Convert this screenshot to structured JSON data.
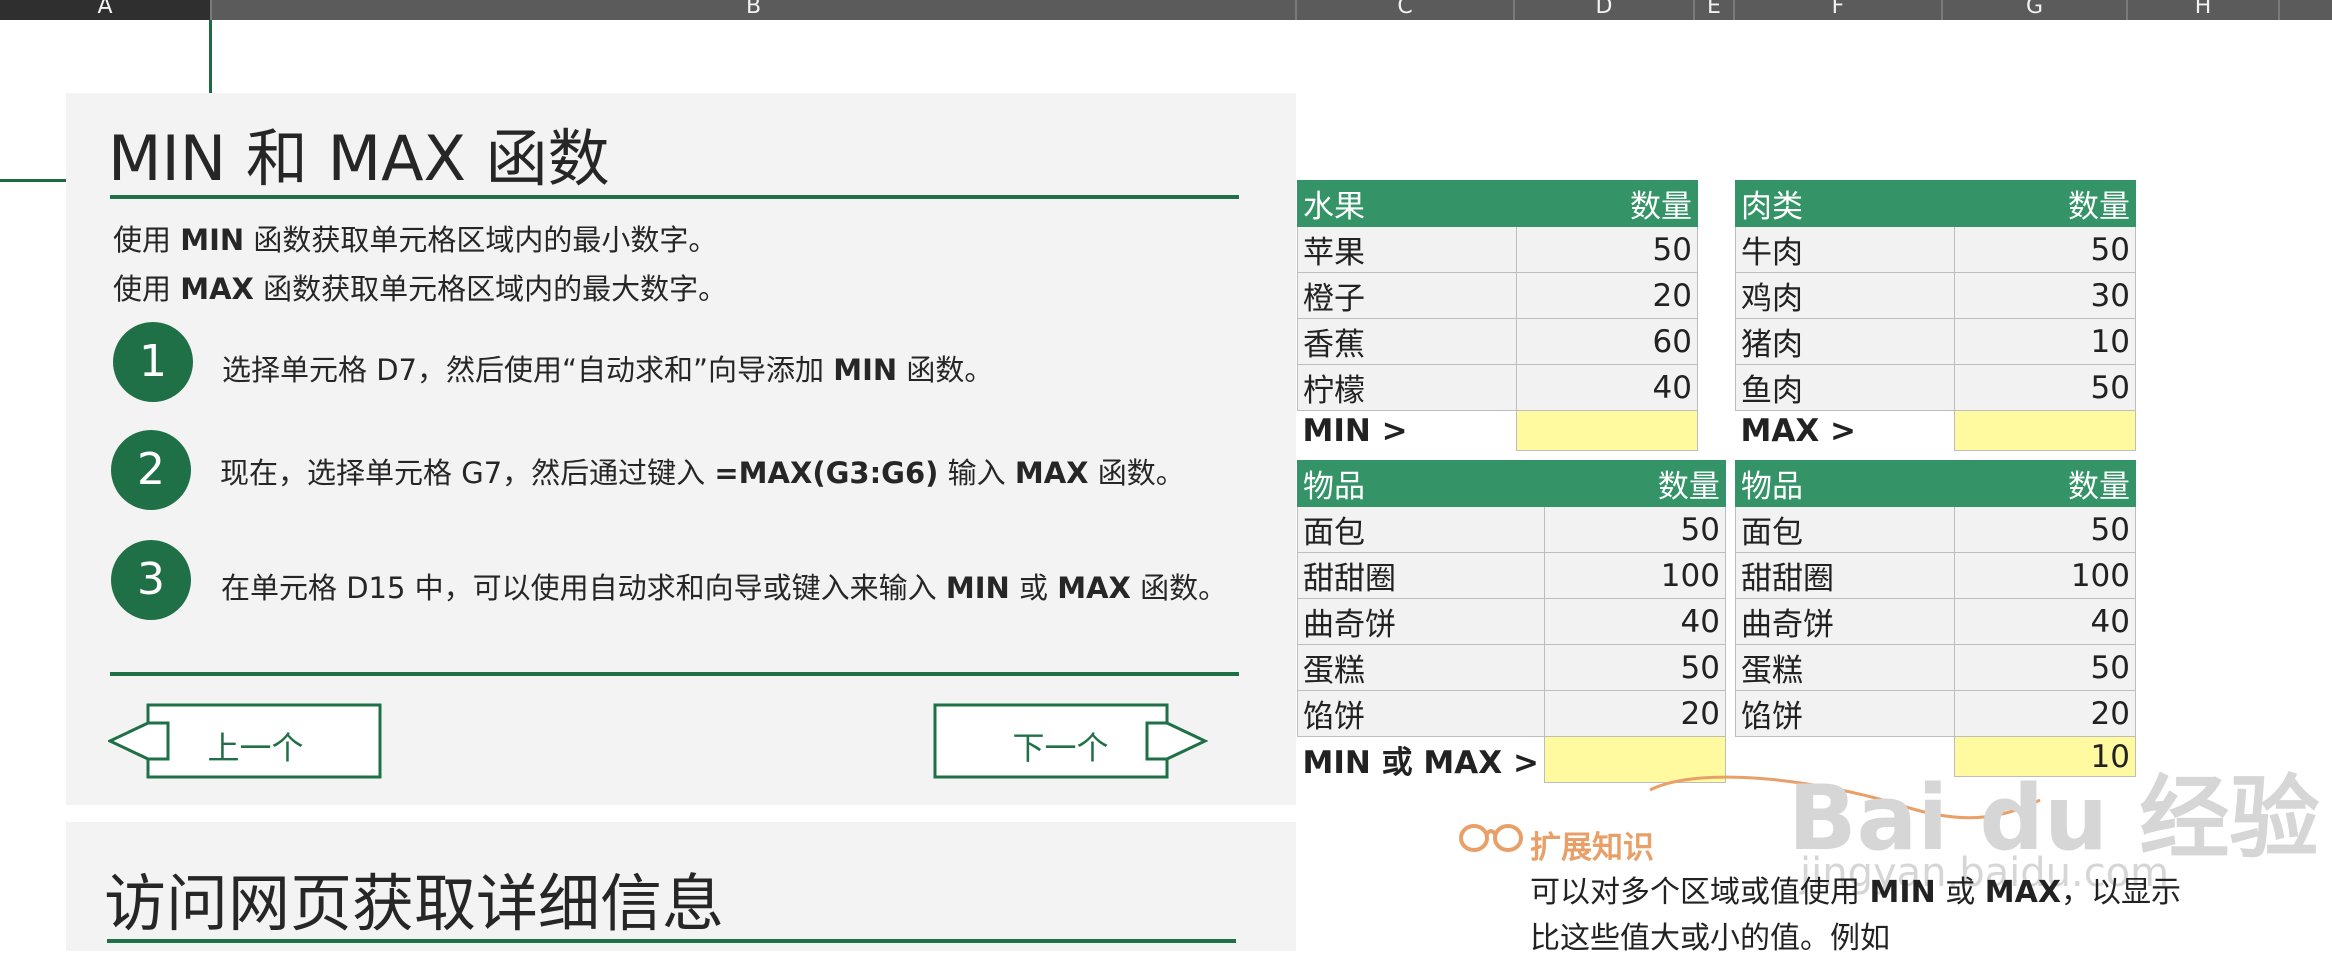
{
  "columns": [
    "A",
    "B",
    "C",
    "D",
    "E",
    "F",
    "G",
    "H"
  ],
  "panel1": {
    "title": "MIN 和 MAX 函数",
    "intro_min": [
      "使用 ",
      "MIN",
      " 函数获取单元格区域内的最小数字。"
    ],
    "intro_max": [
      "使用 ",
      "MAX",
      " 函数获取单元格区域内的最大数字。"
    ],
    "steps": [
      {
        "num": "1",
        "parts": [
          "选择单元格 D7，然后使用“自动求和”向导添加 ",
          "MIN",
          " 函数。"
        ]
      },
      {
        "num": "2",
        "parts": [
          "现在，选择单元格 G7，然后通过键入 ",
          "=MAX(G3:G6)",
          " 输入 ",
          "MAX",
          " 函数。"
        ]
      },
      {
        "num": "3",
        "parts": [
          "在单元格 D15 中，可以使用自动求和向导或键入来输入 ",
          "MIN",
          " 或 ",
          "MAX",
          " 函数。"
        ]
      }
    ],
    "prev_label": "上一个",
    "next_label": "下一个"
  },
  "panel2": {
    "title": "访问网页获取详细信息"
  },
  "tables": {
    "fruit": {
      "h1": "水果",
      "h2": "数量",
      "rows": [
        [
          "苹果",
          "50"
        ],
        [
          "橙子",
          "20"
        ],
        [
          "香蕉",
          "60"
        ],
        [
          "柠檬",
          "40"
        ]
      ],
      "label": "MIN >",
      "result": ""
    },
    "meat": {
      "h1": "肉类",
      "h2": "数量",
      "rows": [
        [
          "牛肉",
          "50"
        ],
        [
          "鸡肉",
          "30"
        ],
        [
          "猪肉",
          "10"
        ],
        [
          "鱼肉",
          "50"
        ]
      ],
      "label": "MAX >",
      "result": ""
    },
    "items1": {
      "h1": "物品",
      "h2": "数量",
      "rows": [
        [
          "面包",
          "50"
        ],
        [
          "甜甜圈",
          "100"
        ],
        [
          "曲奇饼",
          "40"
        ],
        [
          "蛋糕",
          "50"
        ],
        [
          "馅饼",
          "20"
        ]
      ],
      "label": "MIN 或 MAX >",
      "result": ""
    },
    "items2": {
      "h1": "物品",
      "h2": "数量",
      "rows": [
        [
          "面包",
          "50"
        ],
        [
          "甜甜圈",
          "100"
        ],
        [
          "曲奇饼",
          "40"
        ],
        [
          "蛋糕",
          "50"
        ],
        [
          "馅饼",
          "20"
        ]
      ],
      "label": "",
      "result": "10"
    }
  },
  "knowledge": {
    "title": "扩展知识",
    "line1": [
      "可以对多个区域或值使用 ",
      "MIN",
      " 或 ",
      "MAX",
      "，以显示"
    ],
    "line2": "比这些值大或小的值。例如"
  },
  "watermark": {
    "brand": "Bai du 经验",
    "url": "jingyan.baidu.com"
  },
  "colors": {
    "accent": "#1f7047",
    "table_header": "#349467",
    "highlight": "#fffaa0",
    "knowledge": "#e8a068"
  }
}
